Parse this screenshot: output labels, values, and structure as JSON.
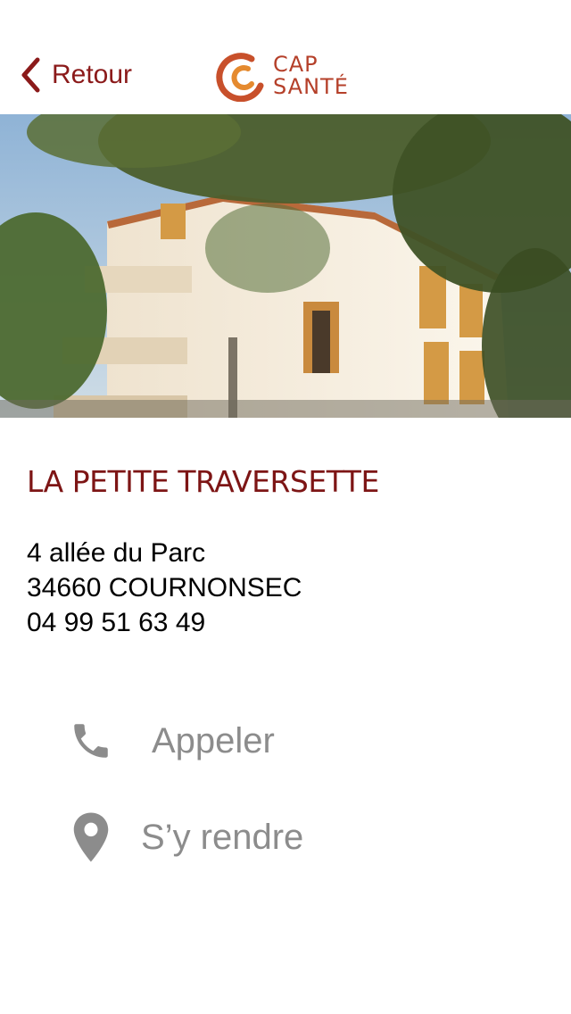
{
  "nav": {
    "back_label": "Retour",
    "logo_line1": "CAP",
    "logo_line2": "SANTÉ"
  },
  "colors": {
    "accent": "#8b1a1a",
    "logo": "#d0582f",
    "action_text": "#8c8c8c"
  },
  "place": {
    "name": "LA PETITE TRAVERSETTE",
    "street": "4 allée du Parc",
    "city": "34660 COURNONSEC",
    "phone": "04 99 51 63 49"
  },
  "actions": {
    "call_label": "Appeler",
    "call_icon": "phone-icon",
    "directions_label": "S’y rendre",
    "directions_icon": "map-pin-icon"
  }
}
